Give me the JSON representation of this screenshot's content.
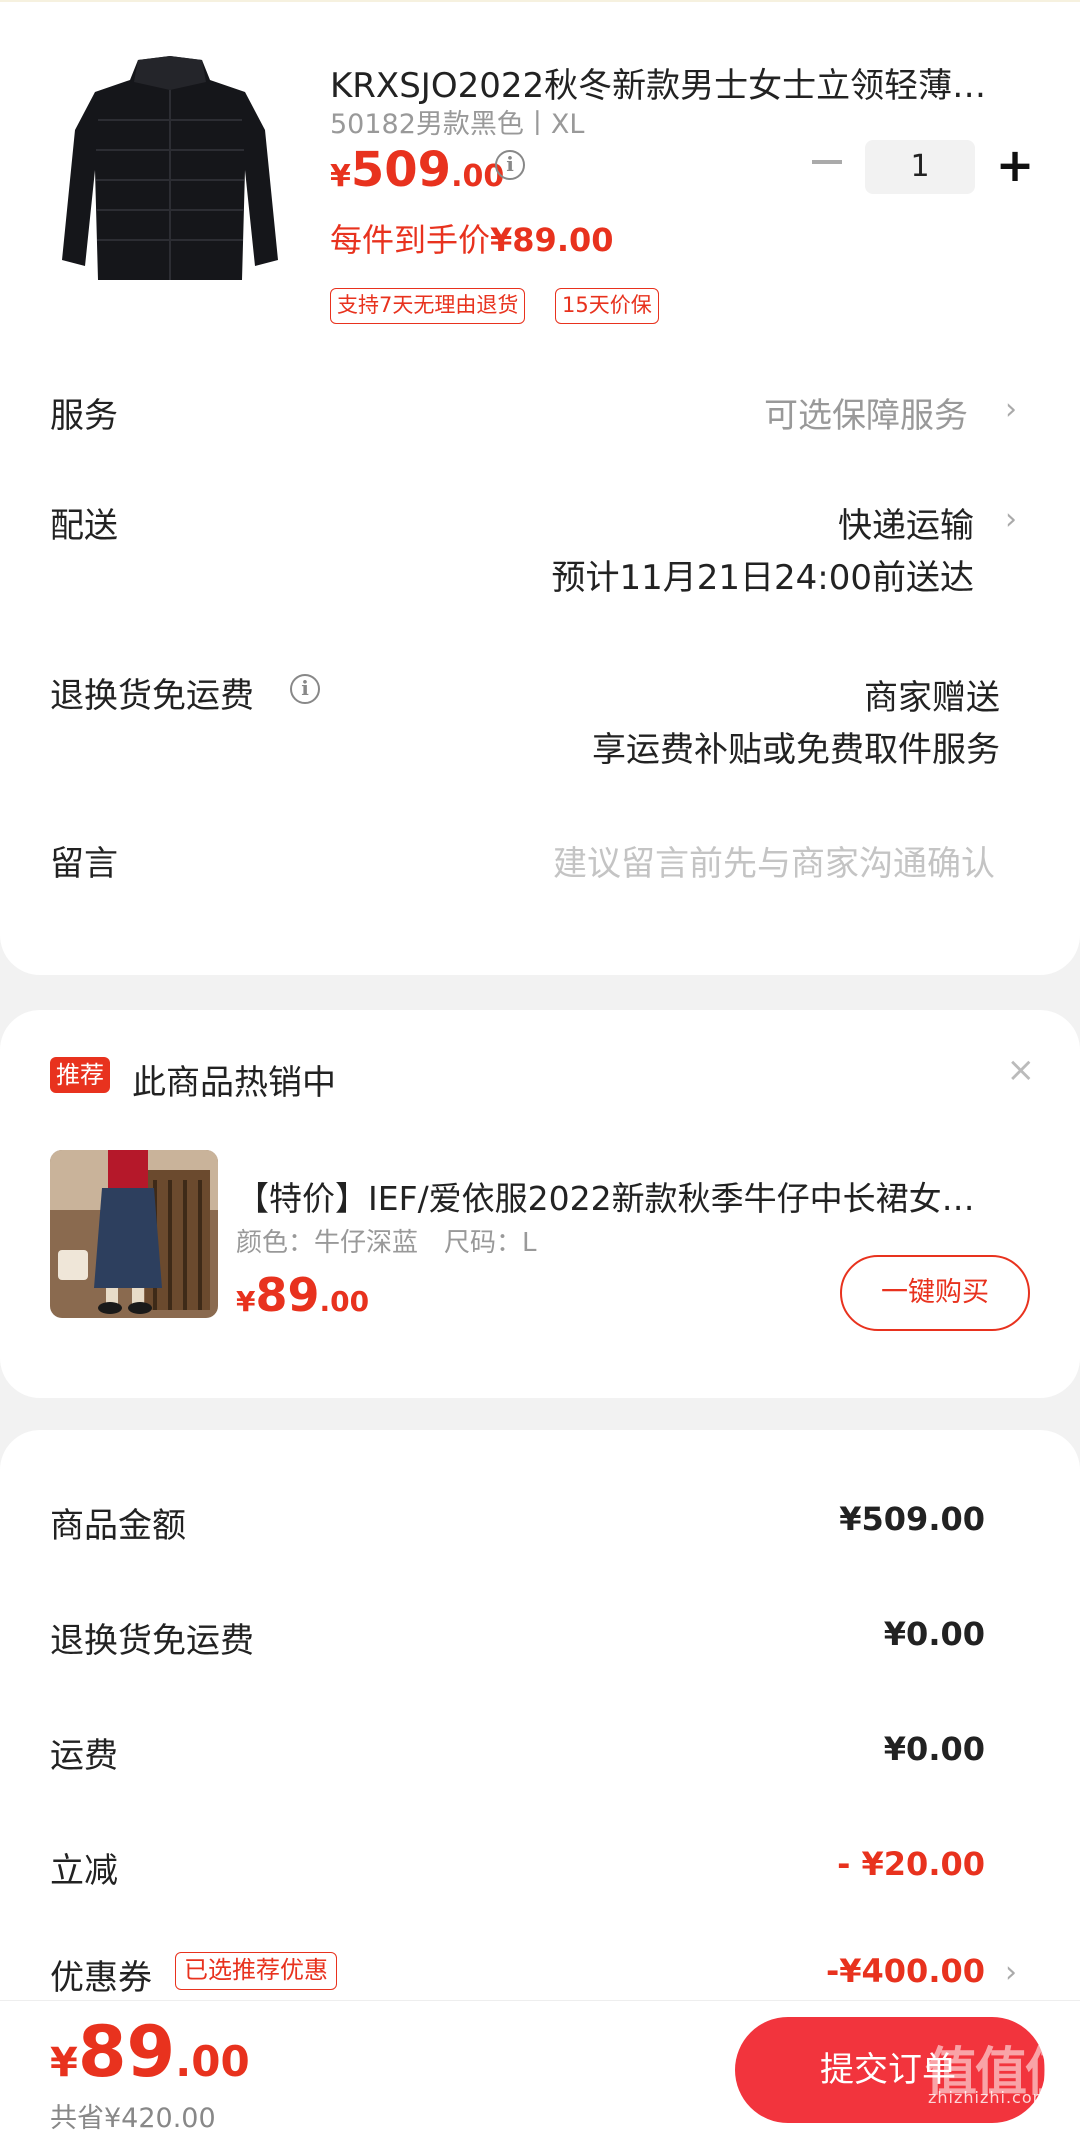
{
  "product": {
    "title": "KRXSJO2022秋冬新款男士女士立领轻薄…",
    "spec": "50182男款黑色丨XL",
    "price_yen": "¥",
    "price_int": "509",
    "price_dec": ".00",
    "deal_price_label": "每件到手价",
    "deal_price_value": "¥89.00",
    "tags": [
      "支持7天无理由退货",
      "15天价保"
    ],
    "quantity": "1"
  },
  "rows": {
    "service_label": "服务",
    "service_value": "可选保障服务",
    "delivery_label": "配送",
    "delivery_value": "快递运输",
    "delivery_eta": "预计11月21日24:00前送达",
    "return_label": "退换货免运费",
    "return_value": "商家赠送",
    "return_desc": "享运费补贴或免费取件服务",
    "message_label": "留言",
    "message_placeholder": "建议留言前先与商家沟通确认"
  },
  "recommend": {
    "badge": "推荐",
    "title": "此商品热销中",
    "close": "×",
    "name": "【特价】IEF/爱依服2022新款秋季牛仔中长裙女…",
    "spec": "颜色：牛仔深蓝　尺码：L",
    "price_yen": "¥",
    "price_int": "89",
    "price_dec": ".00",
    "button": "一键购买"
  },
  "summary": {
    "goods_label": "商品金额",
    "goods_value": "¥509.00",
    "return_label": "退换货免运费",
    "return_value": "¥0.00",
    "shipping_label": "运费",
    "shipping_value": "¥0.00",
    "discount_label": "立减",
    "discount_value": "- ¥20.00",
    "coupon_label": "优惠券",
    "coupon_tag": "已选推荐优惠",
    "coupon_value": "-¥400.00"
  },
  "bottom": {
    "total_yen": "¥",
    "total_int": "89",
    "total_dec": ".00",
    "saved": "共省¥420.00",
    "submit": "提交订单"
  },
  "watermark": {
    "logo": "值值值",
    "url": "zhizhizhi.com"
  },
  "colors": {
    "accent": "#e8321e",
    "submit": "#f2343d",
    "background": "#f2f2f2"
  }
}
